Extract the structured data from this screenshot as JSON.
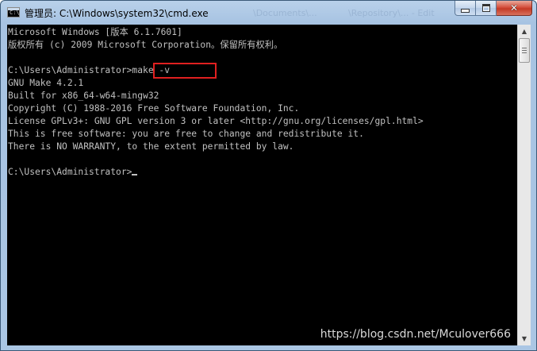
{
  "window": {
    "title": "管理员: C:\\Windows\\system32\\cmd.exe",
    "background_title_1": "\\Documents\\...",
    "background_title_2": "\\Repository\\... - Edit",
    "close_symbol": "✕",
    "icon_label": "C:\\"
  },
  "colors": {
    "console_bg": "#000000",
    "console_text": "#c0c0c0",
    "highlight_border": "#e02020",
    "titlebar": "#b9d1ea",
    "close_button": "#c43a25"
  },
  "console": {
    "lines": [
      "Microsoft Windows [版本 6.1.7601]",
      "版权所有 (c) 2009 Microsoft Corporation。保留所有权利。",
      "",
      "C:\\Users\\Administrator>make -v",
      "GNU Make 4.2.1",
      "Built for x86_64-w64-mingw32",
      "Copyright (C) 1988-2016 Free Software Foundation, Inc.",
      "License GPLv3+: GNU GPL version 3 or later <http://gnu.org/licenses/gpl.html>",
      "This is free software: you are free to change and redistribute it.",
      "There is NO WARRANTY, to the extent permitted by law.",
      "",
      "C:\\Users\\Administrator>"
    ],
    "highlighted_command": "make -v"
  },
  "scrollbar": {
    "up_arrow": "▲",
    "down_arrow": "▼"
  },
  "watermark": "https://blog.csdn.net/Mculover666"
}
